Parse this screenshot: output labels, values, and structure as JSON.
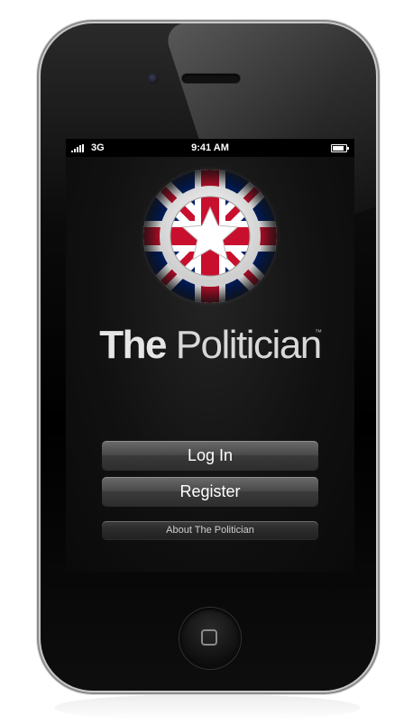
{
  "status_bar": {
    "network": "3G",
    "time": "9:41 AM"
  },
  "app": {
    "brand_bold": "The",
    "brand_light": "Politician",
    "trademark": "™",
    "logo_icon": "star-in-union-jack-circle-icon"
  },
  "buttons": {
    "login_label": "Log In",
    "register_label": "Register",
    "about_label": "About The Politician"
  },
  "colors": {
    "flag_red": "#c8102e",
    "flag_blue": "#012169",
    "screen_bg": "#111111",
    "button_gradient_top": "#6b6b6b"
  }
}
